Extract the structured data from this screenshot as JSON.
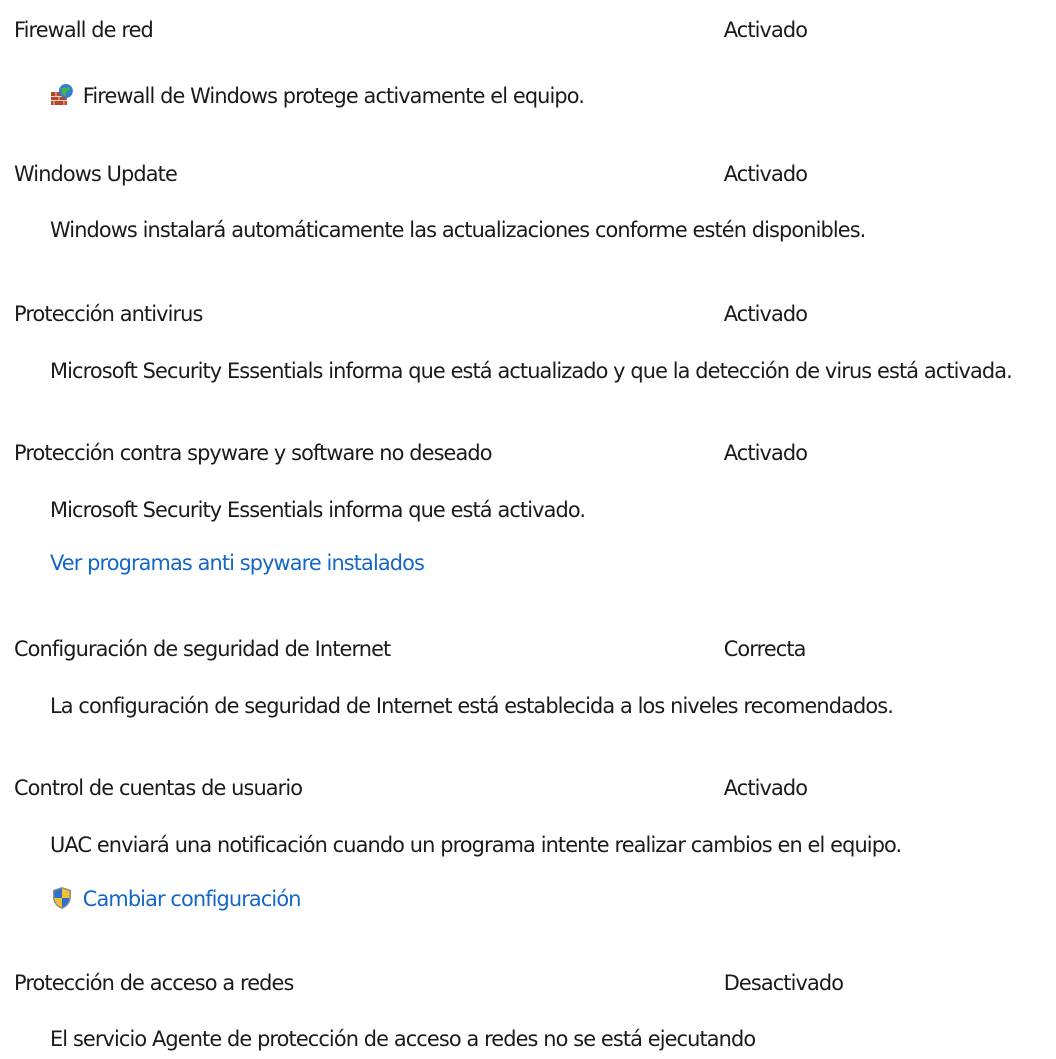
{
  "sections": {
    "firewall": {
      "title": "Firewall de red",
      "status": "Activado",
      "description": "Firewall de Windows protege activamente el equipo.",
      "icon": "firewall-icon"
    },
    "windows_update": {
      "title": "Windows Update",
      "status": "Activado",
      "description": "Windows instalará automáticamente las actualizaciones conforme estén disponibles."
    },
    "antivirus": {
      "title": "Protección antivirus",
      "status": "Activado",
      "description": "Microsoft Security Essentials informa que está actualizado y que la detección de virus está activada."
    },
    "spyware": {
      "title": "Protección contra spyware y software no deseado",
      "status": "Activado",
      "description": "Microsoft Security Essentials informa que está activado.",
      "link": "Ver programas anti spyware instalados"
    },
    "internet_security": {
      "title": "Configuración de seguridad de Internet",
      "status": "Correcta",
      "description": "La configuración de seguridad de Internet está establecida a los niveles recomendados."
    },
    "uac": {
      "title": "Control de cuentas de usuario",
      "status": "Activado",
      "description": "UAC enviará una notificación cuando un programa intente realizar cambios en el equipo.",
      "link": "Cambiar configuración",
      "icon": "uac-shield-icon"
    },
    "nap": {
      "title": "Protección de acceso a redes",
      "status": "Desactivado",
      "description": "El servicio Agente de protección de acceso a redes no se está ejecutando"
    }
  },
  "colors": {
    "text": "#1a1a1a",
    "link": "#1467c6",
    "background": "#ffffff"
  }
}
